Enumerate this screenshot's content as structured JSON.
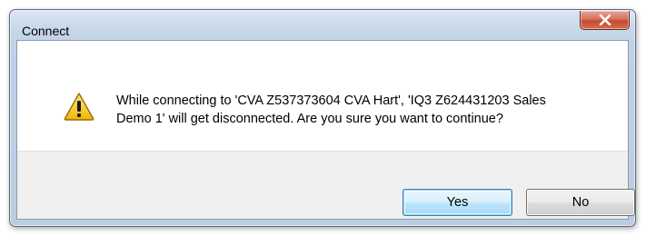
{
  "dialog": {
    "title": "Connect",
    "close_icon": "close-x-icon",
    "icon": "warning-triangle-icon",
    "message_lines": [
      "While connecting to 'CVA Z537373604 CVA Hart',  'IQ3 Z624431203 Sales",
      "Demo 1' will get disconnected. Are you sure you want to continue?"
    ],
    "buttons": {
      "yes_label": "Yes",
      "no_label": "No"
    }
  },
  "colors": {
    "title_bar": "#c9d8ea",
    "close_button": "#c44a2f",
    "footer_bg": "#f0f0f0",
    "default_button_border": "#3c7fb1",
    "warning_fill": "#f5c518"
  }
}
